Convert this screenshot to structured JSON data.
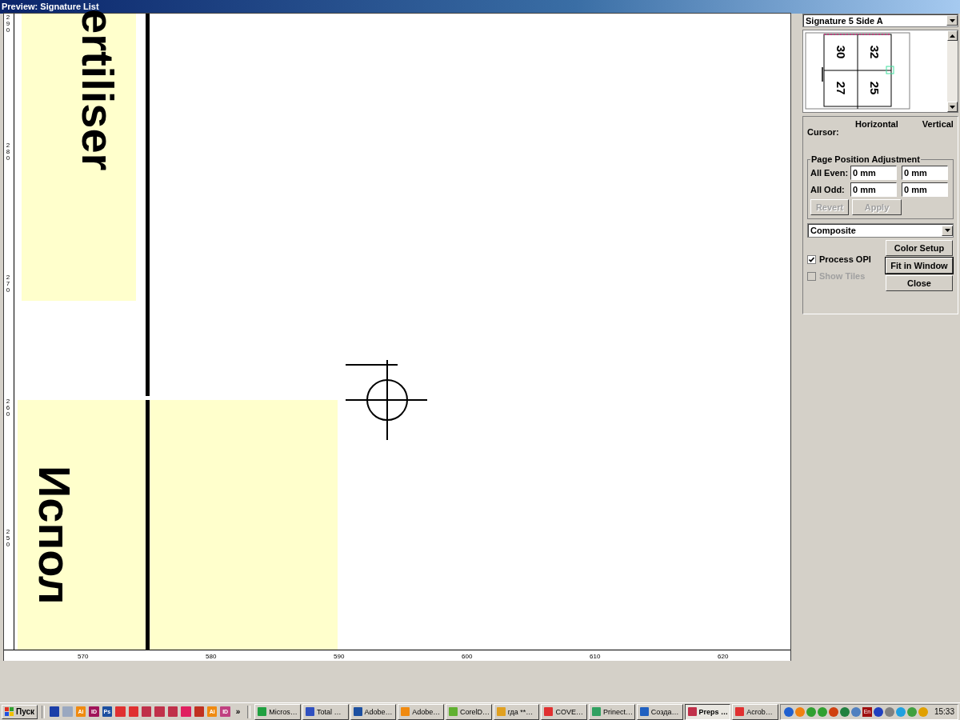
{
  "window": {
    "title": "Preview: Signature List"
  },
  "canvas": {
    "texts": [
      {
        "kind": "top",
        "text": "ertiliser"
      },
      {
        "kind": "bottom",
        "text": "Испол"
      }
    ],
    "left_ruler": [
      "290",
      "280",
      "270",
      "260",
      "250"
    ],
    "bottom_ruler": [
      "570",
      "580",
      "590",
      "600",
      "610",
      "620"
    ]
  },
  "panel": {
    "signature": "Signature 5 Side A",
    "thumbnail": {
      "pages": [
        "30",
        "32",
        "27",
        "25"
      ]
    },
    "columns": [
      "Horizontal",
      "Vertical"
    ],
    "cursor_label": "Cursor:",
    "group_title": "Page Position Adjustment",
    "rows": [
      {
        "label": "All Even:",
        "horizontal": "0 mm",
        "vertical": "0 mm"
      },
      {
        "label": "All Odd:",
        "horizontal": "0 mm",
        "vertical": "0 mm"
      }
    ],
    "revert": {
      "label": "Revert",
      "disabled": true
    },
    "apply": {
      "label": "Apply",
      "disabled": true
    },
    "mode": "Composite",
    "checks": [
      {
        "label": "Process OPI",
        "checked": true,
        "disabled": false
      },
      {
        "label": "Show Tiles",
        "checked": false,
        "disabled": true
      }
    ],
    "buttons": [
      {
        "label": "Color Setup",
        "default": false
      },
      {
        "label": "Fit in Window",
        "default": true
      },
      {
        "label": "Close",
        "default": false
      }
    ]
  },
  "taskbar": {
    "start": "Пуск",
    "quick_launch": [
      {
        "color": "#1c3fa8"
      },
      {
        "color": "#9aa8c0"
      },
      {
        "label": "Ai",
        "color": "#f08a10"
      },
      {
        "label": "ID",
        "color": "#a0145a"
      },
      {
        "label": "Ps",
        "color": "#1c4fa0"
      },
      {
        "color": "#e03030"
      },
      {
        "color": "#e03030"
      },
      {
        "color": "#c0304a"
      },
      {
        "color": "#c0304a"
      },
      {
        "color": "#c0304a"
      },
      {
        "color": "#e02060"
      },
      {
        "color": "#c03020"
      },
      {
        "label": "Ai",
        "color": "#f08a10"
      },
      {
        "label": "ID",
        "color": "#c04080"
      }
    ],
    "more": "»",
    "tasks": [
      {
        "label": "Micros…",
        "color": "#20a040",
        "selected": false
      },
      {
        "label": "Total …",
        "color": "#3050c0",
        "selected": false
      },
      {
        "label": "Adobe…",
        "color": "#1c4fa0",
        "selected": false
      },
      {
        "label": "Adobe…",
        "color": "#f08a10",
        "selected": false
      },
      {
        "label": "CorelD…",
        "color": "#60b030",
        "selected": false
      },
      {
        "label": "гда **…",
        "color": "#e0a020",
        "selected": false
      },
      {
        "label": "COVE…",
        "color": "#e03030",
        "selected": false
      },
      {
        "label": "Prinect…",
        "color": "#30a060",
        "selected": false
      },
      {
        "label": "Созда…",
        "color": "#2060c0",
        "selected": false
      },
      {
        "label": "Preps …",
        "color": "#c0304a",
        "selected": true
      },
      {
        "label": "Acrob…",
        "color": "#e03030",
        "selected": false
      }
    ],
    "tray": [
      {
        "color": "#2060d0"
      },
      {
        "color": "#f08010"
      },
      {
        "color": "#30a030"
      },
      {
        "color": "#30a030"
      },
      {
        "color": "#d04010"
      },
      {
        "color": "#208040"
      },
      {
        "color": "#5080c0"
      },
      {
        "label": "En",
        "color": "#a01010"
      },
      {
        "color": "#2040c0"
      },
      {
        "color": "#808080"
      },
      {
        "color": "#20a0e0"
      },
      {
        "color": "#40a040"
      },
      {
        "color": "#e0a000"
      }
    ],
    "clock": "15:33"
  }
}
